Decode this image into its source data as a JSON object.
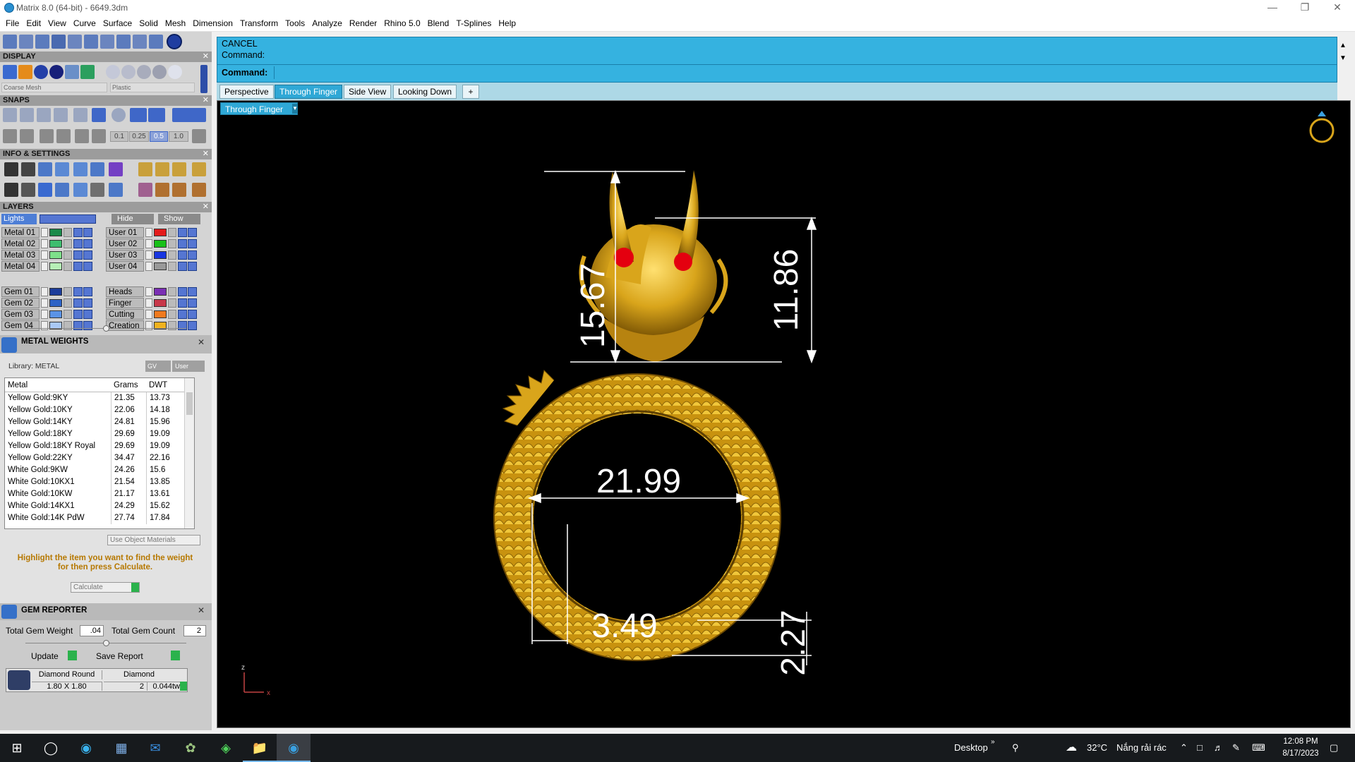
{
  "window": {
    "title": "Matrix 8.0 (64-bit) - 6649.3dm"
  },
  "menu": [
    "File",
    "Edit",
    "View",
    "Curve",
    "Surface",
    "Solid",
    "Mesh",
    "Dimension",
    "Transform",
    "Tools",
    "Analyze",
    "Render",
    "Rhino 5.0",
    "Blend",
    "T-Splines",
    "Help"
  ],
  "sections": {
    "display": "DISPLAY",
    "snaps": "SNAPS",
    "info": "INFO & SETTINGS",
    "layers": "LAYERS",
    "metal_weights": "METAL WEIGHTS",
    "gem_reporter": "GEM REPORTER"
  },
  "display": {
    "mesh_select": "Coarse Mesh",
    "material_select": "Plastic"
  },
  "snaps": {
    "values": [
      "0.1",
      "0.25",
      "0.5",
      "1.0"
    ]
  },
  "layers": {
    "lights": "Lights",
    "hide": "Hide",
    "show": "Show",
    "left": [
      {
        "name": "Metal 01",
        "color": "#1a8a4a"
      },
      {
        "name": "Metal 02",
        "color": "#3ebd6e"
      },
      {
        "name": "Metal 03",
        "color": "#7ee08a"
      },
      {
        "name": "Metal 04",
        "color": "#b6f0b6"
      },
      {
        "name": "Gem 01",
        "color": "#1c3c9a"
      },
      {
        "name": "Gem 02",
        "color": "#2d63c6"
      },
      {
        "name": "Gem 03",
        "color": "#5a93e6"
      },
      {
        "name": "Gem 04",
        "color": "#a9c8f4"
      }
    ],
    "right": [
      {
        "name": "User 01",
        "color": "#e41b1b"
      },
      {
        "name": "User 02",
        "color": "#18c018"
      },
      {
        "name": "User 03",
        "color": "#1836e0"
      },
      {
        "name": "User 04",
        "color": "#999999"
      },
      {
        "name": "Heads",
        "color": "#7a2fb4"
      },
      {
        "name": "Finger",
        "color": "#c8384a"
      },
      {
        "name": "Cutting",
        "color": "#f07a1e"
      },
      {
        "name": "Creation",
        "color": "#f0b21e"
      }
    ]
  },
  "metal_weights": {
    "library": "Library: METAL",
    "gv": "GV",
    "user": "User",
    "columns": [
      "Metal",
      "Grams",
      "DWT"
    ],
    "rows": [
      [
        "Yellow Gold:9KY",
        "21.35",
        "13.73"
      ],
      [
        "Yellow Gold:10KY",
        "22.06",
        "14.18"
      ],
      [
        "Yellow Gold:14KY",
        "24.81",
        "15.96"
      ],
      [
        "Yellow Gold:18KY",
        "29.69",
        "19.09"
      ],
      [
        "Yellow Gold:18KY Royal",
        "29.69",
        "19.09"
      ],
      [
        "Yellow Gold:22KY",
        "34.47",
        "22.16"
      ],
      [
        "White Gold:9KW",
        "24.26",
        "15.6"
      ],
      [
        "White Gold:10KX1",
        "21.54",
        "13.85"
      ],
      [
        "White Gold:10KW",
        "21.17",
        "13.61"
      ],
      [
        "White Gold:14KX1",
        "24.29",
        "15.62"
      ],
      [
        "White Gold:14K PdW",
        "27.74",
        "17.84"
      ]
    ],
    "use_object_materials": "Use Object Materials",
    "hint": "Highlight the item you want to find the weight for then press Calculate.",
    "calculate": "Calculate"
  },
  "gem_reporter": {
    "total_weight_label": "Total Gem Weight",
    "total_weight_value": ".04",
    "total_count_label": "Total Gem Count",
    "total_count_value": "2",
    "update": "Update",
    "save_report": "Save Report",
    "gem_cut": "Diamond Round",
    "gem_type": "Diamond",
    "gem_size": "1.80 X 1.80",
    "gem_qty": "2",
    "gem_weight": "0.044tw"
  },
  "command": {
    "line1": "CANCEL",
    "line2": "Command:",
    "prompt": "Command:",
    "input": ""
  },
  "viewtabs": [
    {
      "label": "Perspective",
      "active": false
    },
    {
      "label": "Through Finger",
      "active": true
    },
    {
      "label": "Side View",
      "active": false
    },
    {
      "label": "Looking Down",
      "active": false
    }
  ],
  "viewport": {
    "view_select": "Through Finger",
    "dimensions": {
      "height_left": "15.67",
      "height_right": "11.86",
      "inner_diameter": "21.99",
      "shank_width": "3.49",
      "shank_thickness": "2.27"
    },
    "axis_z": "z",
    "axis_x": "x"
  },
  "taskbar": {
    "desktop": "Desktop",
    "temp": "32°C",
    "weather": "Nắng rải rác",
    "time": "12:08 PM",
    "date": "8/17/2023"
  },
  "colors": {
    "accent": "#35b2e0",
    "gold": "#d9a51b",
    "viewport_bg": "#000000",
    "panel": "#d4d4d4"
  }
}
